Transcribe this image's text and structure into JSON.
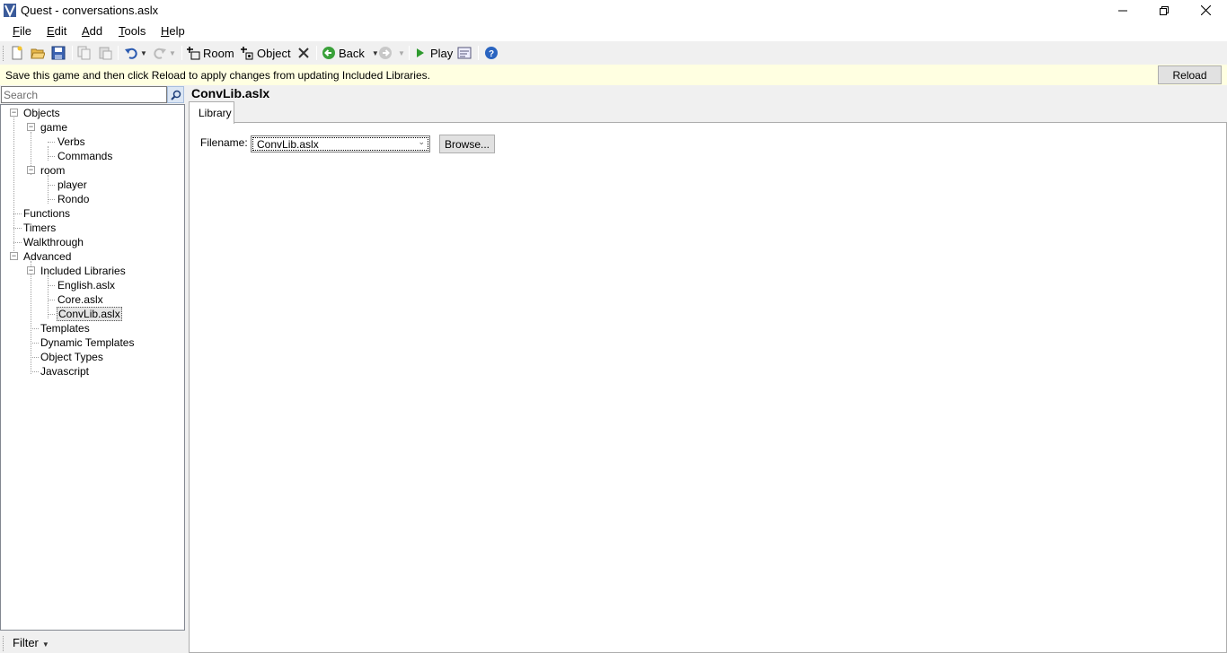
{
  "window": {
    "title": "Quest - conversations.aslx"
  },
  "menu": [
    {
      "label": "File",
      "key": "F",
      "rest": "ile"
    },
    {
      "label": "Edit",
      "key": "E",
      "rest": "dit"
    },
    {
      "label": "Add",
      "key": "A",
      "rest": "dd"
    },
    {
      "label": "Tools",
      "key": "T",
      "rest": "ools"
    },
    {
      "label": "Help",
      "key": "H",
      "rest": "elp"
    }
  ],
  "toolbar": {
    "room_label": "Room",
    "object_label": "Object",
    "back_label": "Back",
    "play_label": "Play"
  },
  "infobar": {
    "message": "Save this game and then click Reload to apply changes from updating Included Libraries.",
    "reload_label": "Reload"
  },
  "search": {
    "placeholder": "Search"
  },
  "tree": {
    "objects": "Objects",
    "game": "game",
    "verbs": "Verbs",
    "commands": "Commands",
    "room": "room",
    "player": "player",
    "rondo": "Rondo",
    "functions": "Functions",
    "timers": "Timers",
    "walkthrough": "Walkthrough",
    "advanced": "Advanced",
    "included_libraries": "Included Libraries",
    "english": "English.aslx",
    "core": "Core.aslx",
    "convlib": "ConvLib.aslx",
    "templates": "Templates",
    "dynamic_templates": "Dynamic Templates",
    "object_types": "Object Types",
    "javascript": "Javascript"
  },
  "filter": {
    "label": "Filter"
  },
  "editor": {
    "title": "ConvLib.aslx",
    "tab": "Library",
    "filename_label": "Filename:",
    "filename_value": "ConvLib.aslx",
    "browse_label": "Browse..."
  },
  "colors": {
    "infobar_bg": "#ffffe1",
    "selected_bg": "#e5e5e5"
  }
}
